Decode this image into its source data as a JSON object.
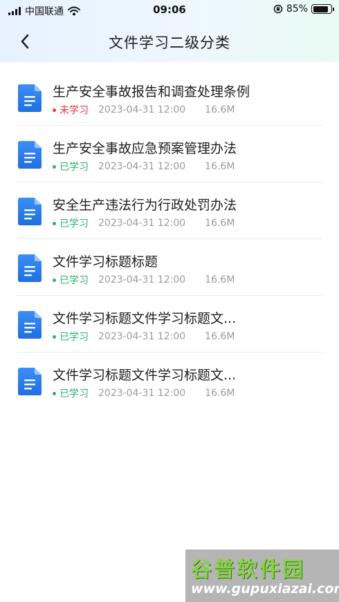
{
  "status_bar": {
    "carrier": "中国联通",
    "time": "09:06",
    "battery": "85%",
    "battery_level": 0.85
  },
  "nav": {
    "title": "文件学习二级分类",
    "back_icon": "chevron-left-icon"
  },
  "colors": {
    "unlearned": "#e8353a",
    "learned": "#27b36a",
    "icon_blue": "#2a7ff0"
  },
  "documents": [
    {
      "title": "生产安全事故报告和调查处理条例",
      "status": "未学习",
      "date": "2023-04-31 12:00",
      "size": "16.6M"
    },
    {
      "title": "生产安全事故应急预案管理办法",
      "status": "已学习",
      "date": "2023-04-31 12:00",
      "size": "16.6M"
    },
    {
      "title": "安全生产违法行为行政处罚办法",
      "status": "已学习",
      "date": "2023-04-31 12:00",
      "size": "16.6M"
    },
    {
      "title": "文件学习标题标题",
      "status": "已学习",
      "date": "2023-04-31 12:00",
      "size": "16.6M"
    },
    {
      "title": "文件学习标题文件学习标题文...",
      "status": "已学习",
      "date": "2023-04-31 12:00",
      "size": "16.6M"
    },
    {
      "title": "文件学习标题文件学习标题文...",
      "status": "已学习",
      "date": "2023-04-31 12:00",
      "size": "16.6M"
    }
  ],
  "watermark": {
    "title": "谷普软件园",
    "url": "www.gupuxiazai.com"
  }
}
